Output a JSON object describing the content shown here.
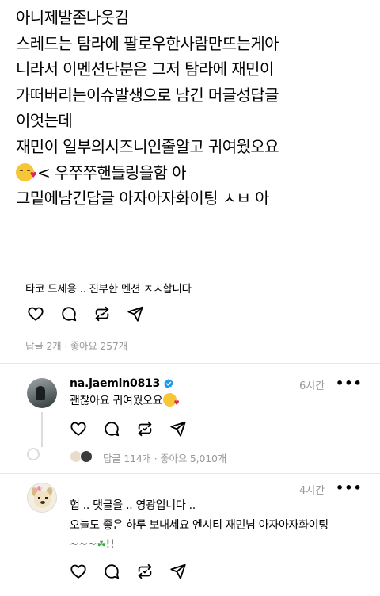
{
  "post": {
    "lines": [
      "아니제발존나웃김",
      "스레드는 탐라에 팔로우한사람만뜨는게아",
      "니라서 이멘션단분은 그저 탐라에 재민이",
      "가떠버리는이슈발생으로 남긴 머글성답글",
      "이엇는데",
      "재민이 일부의시즈니인줄알고 귀여웠오요",
      "< 우쭈쭈핸들링을함 아",
      "그밑에남긴답글 아자아자화이팅 ㅅㅂ 아"
    ],
    "emoji": "kissing-face-with-heart",
    "quoted_translation": "타코 드세용 .. 진부한 멘션 ㅈㅅ합니다",
    "stats": "답글 2개 · 좋아요 257개"
  },
  "replies": [
    {
      "username": "na.jaemin0813",
      "verified": true,
      "time": "6시간",
      "text": "괜찮아요 귀여웠오요",
      "emoji": "kissing-face-with-heart",
      "stats": "답글 114개 · 좋아요 5,010개"
    },
    {
      "username": "",
      "time": "4시간",
      "lines": [
        "헙 .. 댓글을 .. 영광입니다 ..",
        "오늘도 좋은 하루 보내세요 엔시티 재민님 아자아자화이팅",
        "~~~",
        "!!"
      ],
      "emoji": "four-leaf-clover"
    }
  ],
  "actions": [
    "heart-icon",
    "comment-icon",
    "repost-icon",
    "send-icon"
  ],
  "more_label": "•••",
  "colors": {
    "muted": "#999999",
    "divider": "#e6e6e6",
    "verified": "#1d9bf0"
  }
}
